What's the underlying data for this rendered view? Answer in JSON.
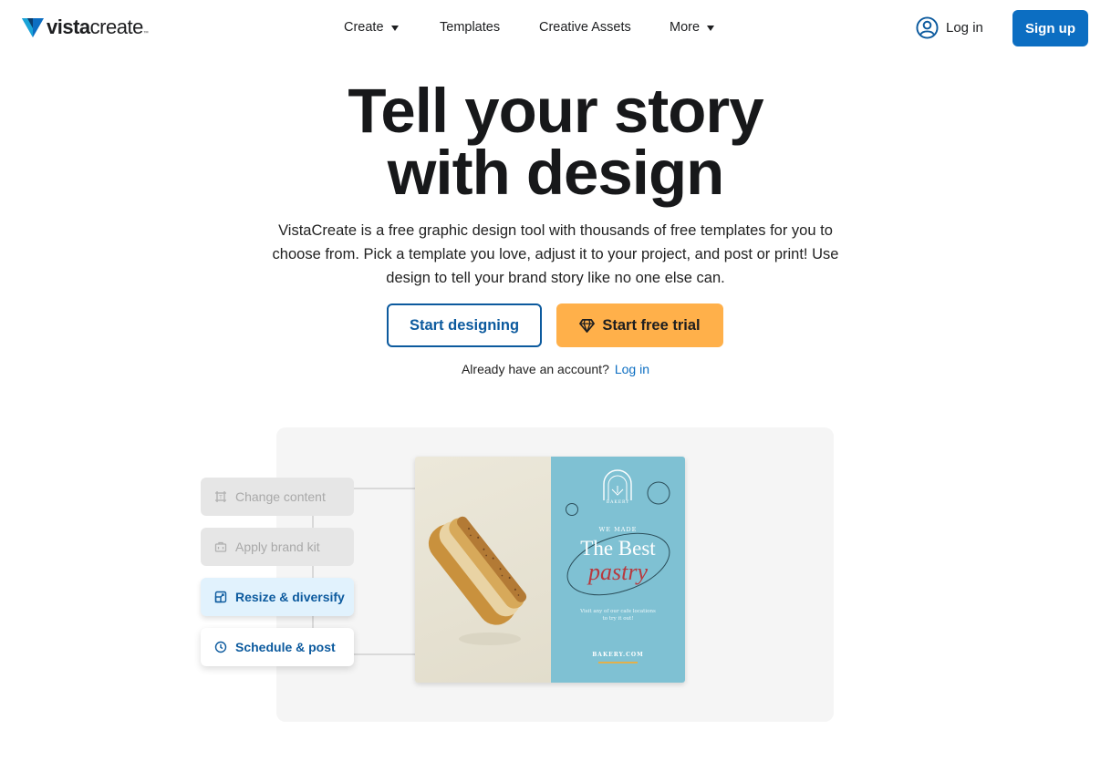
{
  "header": {
    "logo": {
      "bold": "vista",
      "regular": "create",
      "tm": "™"
    },
    "nav": [
      {
        "label": "Create",
        "has_caret": true
      },
      {
        "label": "Templates",
        "has_caret": false
      },
      {
        "label": "Creative Assets",
        "has_caret": false
      },
      {
        "label": "More",
        "has_caret": true
      }
    ],
    "login_label": "Log in",
    "signup_label": "Sign up"
  },
  "hero": {
    "title_line1": "Tell your story",
    "title_line2": "with design",
    "description": "VistaCreate is a free graphic design tool with thousands of free templates for you to choose from. Pick a template you love, adjust it to your project, and post or print! Use design to tell your brand story like no one else can.",
    "start_designing": "Start designing",
    "start_trial": "Start free trial",
    "account_question": "Already have an account?",
    "account_login": "Log in"
  },
  "illustration": {
    "features": [
      {
        "label": "Change content",
        "icon": "crop-icon"
      },
      {
        "label": "Apply brand kit",
        "icon": "briefcase-icon"
      },
      {
        "label": "Resize & diversify",
        "icon": "resize-icon"
      },
      {
        "label": "Schedule & post",
        "icon": "clock-icon"
      }
    ],
    "card": {
      "bakery_logo": "BAKERY",
      "we_made": "WE MADE",
      "the_best": "The Best",
      "pastry": "pastry",
      "small_line1": "Visit any of our cafe locations",
      "small_line2": "to try it out!",
      "website": "BAKERY.COM"
    }
  },
  "colors": {
    "brand_blue": "#0c6ec2",
    "trial_orange": "#ffb04a",
    "card_blue": "#7fc1d3"
  }
}
